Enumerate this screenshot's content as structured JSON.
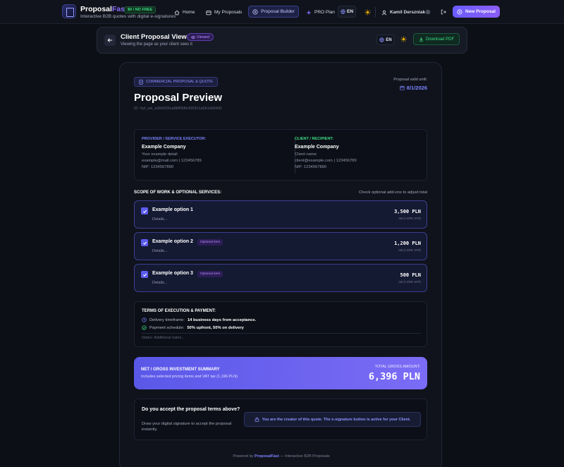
{
  "nav": {
    "brand_main": "Proposal",
    "brand_accent": "Fast",
    "free_badge": "$0 / NO FREE",
    "tagline": "Interactive B2B quotes with digital e-signatures",
    "home": "Home",
    "my_proposals": "My Proposals",
    "builder": "Proposal Builder",
    "pro": "PRO Plan",
    "lang": "EN",
    "user": "Kamil Derszniak",
    "new_proposal": "New Proposal"
  },
  "subheader": {
    "title": "Client Proposal View",
    "badge": "Viewed",
    "desc": "Viewing the page as your client sees it",
    "lang": "EN",
    "download": "Download PDF"
  },
  "doc": {
    "type_label": "COMMERCIAL PROPOSAL & QUOTE",
    "valid_label": "Proposal valid until:",
    "valid_date": "8/1/2026",
    "title": "Proposal Preview",
    "id": "ID: #pf_sel_a3b6939ca8bf058e4353c1a5b1eb54d1"
  },
  "provider": {
    "head": "PROVIDER / SERVICE EXECUTOR:",
    "name": "Example Company",
    "line1": "Your example detail",
    "line2": "example@mail.com | 123456789",
    "line3": "NIP: 1234567890"
  },
  "client": {
    "head": "CLIENT / RECIPIENT:",
    "name": "Example Company",
    "line1": "Client name",
    "line2": "client@example.com | 123456789",
    "line3": "NIP: 1234567890"
  },
  "scope": {
    "head": "SCOPE OF WORK & OPTIONAL SERVICES:",
    "hint": "Check optional add-ons to adjust total"
  },
  "options": [
    {
      "title": "Example option 1",
      "details": "Details...",
      "price": "3,500 PLN",
      "vat": "net (+23% VAT)",
      "badge": ""
    },
    {
      "title": "Example option 2",
      "details": "Details...",
      "price": "1,200 PLN",
      "vat": "net (+23% VAT)",
      "badge": "Optional item"
    },
    {
      "title": "Example option 3",
      "details": "Details...",
      "price": "500 PLN",
      "vat": "net (+23% VAT)",
      "badge": "Optional item"
    }
  ],
  "terms": {
    "head": "TERMS OF EXECUTION & PAYMENT:",
    "delivery_label": "Delivery timeframe:",
    "delivery_value": "14 business days from acceptance.",
    "payment_label": "Payment schedule:",
    "payment_value": "50% upfront, 50% on delivery",
    "notes": "Notes: Additional notes..."
  },
  "summary": {
    "head": "NET / GROSS INVESTMENT SUMMARY",
    "sub": "Includes selected pricing items and VAT tax (1,196 PLN)",
    "label": "TOTAL GROSS AMOUNT:",
    "amount": "6,396 PLN"
  },
  "accept": {
    "question": "Do you accept the proposal terms above?",
    "desc": "Draw your digital signature to accept the proposal instantly.",
    "creator_note": "You are the creator of this quote. The e-signature button is active for your Client."
  },
  "footer": {
    "prefix": "Powered by",
    "brand": "ProposalFast",
    "suffix": "— Interactive B2B Proposals"
  },
  "colors": {
    "accent": "#6a5cff",
    "provider_head": "#7c83ff",
    "client_head": "#3ddc84",
    "background": "#0d0f16"
  }
}
